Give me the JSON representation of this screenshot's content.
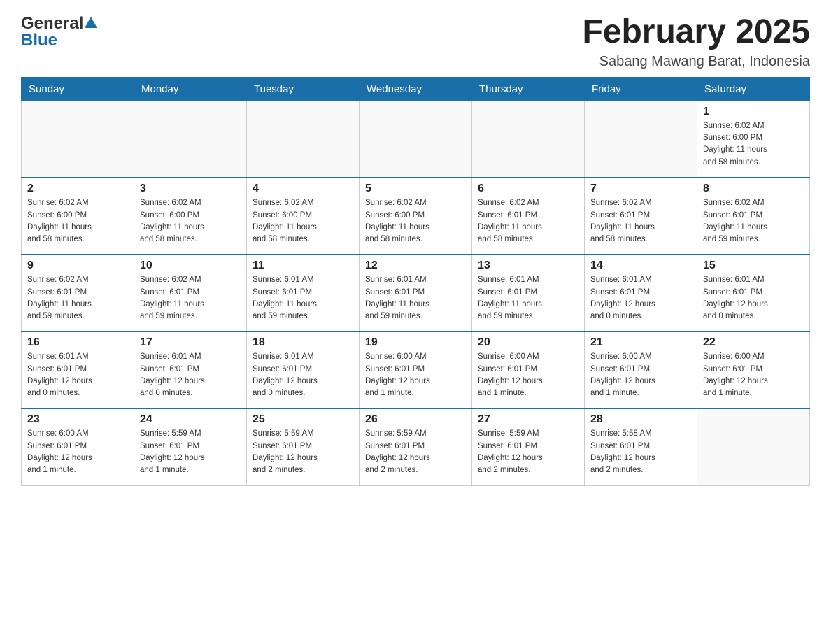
{
  "header": {
    "logo_general": "General",
    "logo_blue": "Blue",
    "month_title": "February 2025",
    "location": "Sabang Mawang Barat, Indonesia"
  },
  "weekdays": [
    "Sunday",
    "Monday",
    "Tuesday",
    "Wednesday",
    "Thursday",
    "Friday",
    "Saturday"
  ],
  "weeks": [
    [
      {
        "day": "",
        "info": ""
      },
      {
        "day": "",
        "info": ""
      },
      {
        "day": "",
        "info": ""
      },
      {
        "day": "",
        "info": ""
      },
      {
        "day": "",
        "info": ""
      },
      {
        "day": "",
        "info": ""
      },
      {
        "day": "1",
        "info": "Sunrise: 6:02 AM\nSunset: 6:00 PM\nDaylight: 11 hours\nand 58 minutes."
      }
    ],
    [
      {
        "day": "2",
        "info": "Sunrise: 6:02 AM\nSunset: 6:00 PM\nDaylight: 11 hours\nand 58 minutes."
      },
      {
        "day": "3",
        "info": "Sunrise: 6:02 AM\nSunset: 6:00 PM\nDaylight: 11 hours\nand 58 minutes."
      },
      {
        "day": "4",
        "info": "Sunrise: 6:02 AM\nSunset: 6:00 PM\nDaylight: 11 hours\nand 58 minutes."
      },
      {
        "day": "5",
        "info": "Sunrise: 6:02 AM\nSunset: 6:00 PM\nDaylight: 11 hours\nand 58 minutes."
      },
      {
        "day": "6",
        "info": "Sunrise: 6:02 AM\nSunset: 6:01 PM\nDaylight: 11 hours\nand 58 minutes."
      },
      {
        "day": "7",
        "info": "Sunrise: 6:02 AM\nSunset: 6:01 PM\nDaylight: 11 hours\nand 58 minutes."
      },
      {
        "day": "8",
        "info": "Sunrise: 6:02 AM\nSunset: 6:01 PM\nDaylight: 11 hours\nand 59 minutes."
      }
    ],
    [
      {
        "day": "9",
        "info": "Sunrise: 6:02 AM\nSunset: 6:01 PM\nDaylight: 11 hours\nand 59 minutes."
      },
      {
        "day": "10",
        "info": "Sunrise: 6:02 AM\nSunset: 6:01 PM\nDaylight: 11 hours\nand 59 minutes."
      },
      {
        "day": "11",
        "info": "Sunrise: 6:01 AM\nSunset: 6:01 PM\nDaylight: 11 hours\nand 59 minutes."
      },
      {
        "day": "12",
        "info": "Sunrise: 6:01 AM\nSunset: 6:01 PM\nDaylight: 11 hours\nand 59 minutes."
      },
      {
        "day": "13",
        "info": "Sunrise: 6:01 AM\nSunset: 6:01 PM\nDaylight: 11 hours\nand 59 minutes."
      },
      {
        "day": "14",
        "info": "Sunrise: 6:01 AM\nSunset: 6:01 PM\nDaylight: 12 hours\nand 0 minutes."
      },
      {
        "day": "15",
        "info": "Sunrise: 6:01 AM\nSunset: 6:01 PM\nDaylight: 12 hours\nand 0 minutes."
      }
    ],
    [
      {
        "day": "16",
        "info": "Sunrise: 6:01 AM\nSunset: 6:01 PM\nDaylight: 12 hours\nand 0 minutes."
      },
      {
        "day": "17",
        "info": "Sunrise: 6:01 AM\nSunset: 6:01 PM\nDaylight: 12 hours\nand 0 minutes."
      },
      {
        "day": "18",
        "info": "Sunrise: 6:01 AM\nSunset: 6:01 PM\nDaylight: 12 hours\nand 0 minutes."
      },
      {
        "day": "19",
        "info": "Sunrise: 6:00 AM\nSunset: 6:01 PM\nDaylight: 12 hours\nand 1 minute."
      },
      {
        "day": "20",
        "info": "Sunrise: 6:00 AM\nSunset: 6:01 PM\nDaylight: 12 hours\nand 1 minute."
      },
      {
        "day": "21",
        "info": "Sunrise: 6:00 AM\nSunset: 6:01 PM\nDaylight: 12 hours\nand 1 minute."
      },
      {
        "day": "22",
        "info": "Sunrise: 6:00 AM\nSunset: 6:01 PM\nDaylight: 12 hours\nand 1 minute."
      }
    ],
    [
      {
        "day": "23",
        "info": "Sunrise: 6:00 AM\nSunset: 6:01 PM\nDaylight: 12 hours\nand 1 minute."
      },
      {
        "day": "24",
        "info": "Sunrise: 5:59 AM\nSunset: 6:01 PM\nDaylight: 12 hours\nand 1 minute."
      },
      {
        "day": "25",
        "info": "Sunrise: 5:59 AM\nSunset: 6:01 PM\nDaylight: 12 hours\nand 2 minutes."
      },
      {
        "day": "26",
        "info": "Sunrise: 5:59 AM\nSunset: 6:01 PM\nDaylight: 12 hours\nand 2 minutes."
      },
      {
        "day": "27",
        "info": "Sunrise: 5:59 AM\nSunset: 6:01 PM\nDaylight: 12 hours\nand 2 minutes."
      },
      {
        "day": "28",
        "info": "Sunrise: 5:58 AM\nSunset: 6:01 PM\nDaylight: 12 hours\nand 2 minutes."
      },
      {
        "day": "",
        "info": ""
      }
    ]
  ]
}
